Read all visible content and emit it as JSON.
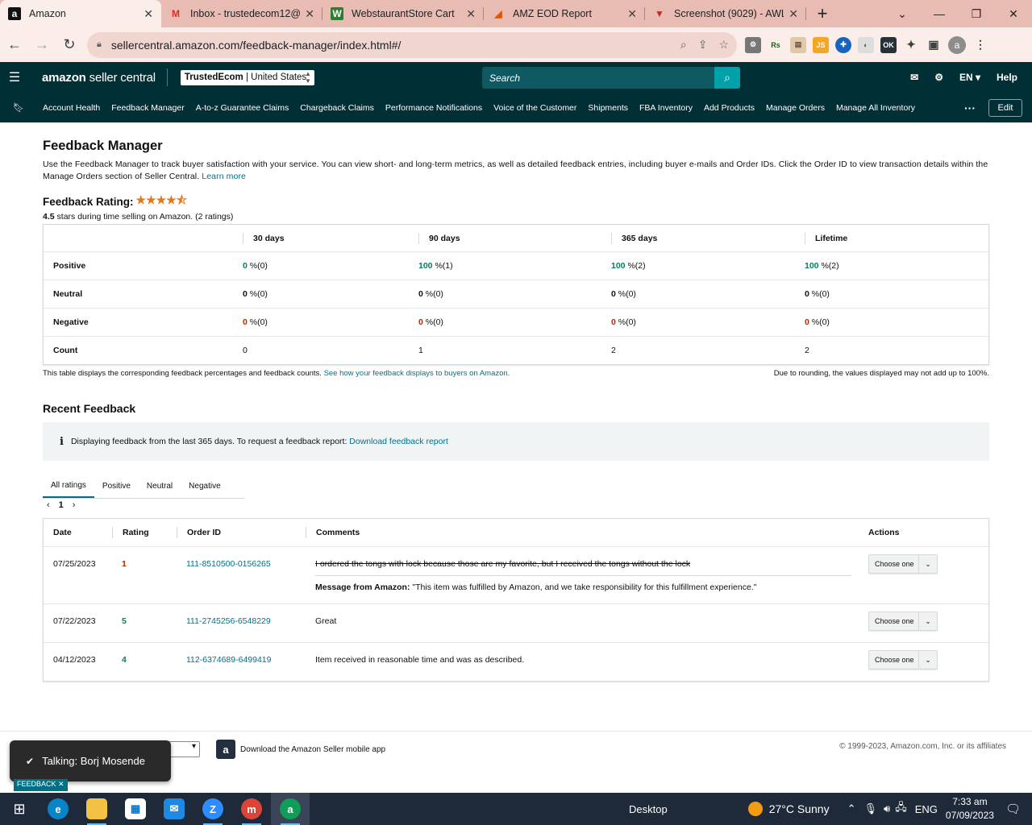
{
  "browser": {
    "tabs": [
      {
        "title": "Amazon",
        "favicon": "a",
        "favicon_bg": "#111111",
        "favicon_color": "#ffffff",
        "active": true
      },
      {
        "title": "Inbox - trustedecom12@g",
        "favicon": "M",
        "favicon_bg": "transparent",
        "favicon_color": "#d93025",
        "active": false
      },
      {
        "title": "WebstaurantStore Cart",
        "favicon": "W",
        "favicon_bg": "#2e7d32",
        "favicon_color": "#ffffff",
        "active": false
      },
      {
        "title": "AMZ EOD Report",
        "favicon": "◢",
        "favicon_bg": "transparent",
        "favicon_color": "#e65100",
        "active": false
      },
      {
        "title": "Screenshot (9029) - AWL",
        "favicon": "▼",
        "favicon_bg": "transparent",
        "favicon_color": "#c62828",
        "active": false
      }
    ],
    "url": "sellercentral.amazon.com/feedback-manager/index.html#/",
    "avatar_letter": "a"
  },
  "header": {
    "brand_bold": "amazon",
    "brand_light": "seller central",
    "account_store": "TrustedEcom",
    "account_region": "United States",
    "search_placeholder": "Search",
    "language": "EN",
    "help": "Help"
  },
  "nav": {
    "items": [
      "Account Health",
      "Feedback Manager",
      "A-to-z Guarantee Claims",
      "Chargeback Claims",
      "Performance Notifications",
      "Voice of the Customer",
      "Shipments",
      "FBA Inventory",
      "Add Products",
      "Manage Orders",
      "Manage All Inventory"
    ],
    "more": "···",
    "edit": "Edit"
  },
  "page": {
    "title": "Feedback Manager",
    "intro": "Use the Feedback Manager to track buyer satisfaction with your service. You can view short- and long-term metrics, as well as detailed feedback entries, including buyer e-mails and Order IDs. Click the Order ID to view transaction details within the Manage Orders section of Seller Central.",
    "learn_more": "Learn more",
    "rating_label": "Feedback Rating:",
    "stars": "★★★★⯪",
    "rating_value": "4.5",
    "rating_rest": " stars during time selling on Amazon. (2 ratings)"
  },
  "metrics": {
    "headers": [
      "30 days",
      "90 days",
      "365 days",
      "Lifetime"
    ],
    "rows": [
      {
        "label": "Positive",
        "cells": [
          [
            "0",
            " %(0)"
          ],
          [
            "100",
            " %(1)"
          ],
          [
            "100",
            " %(2)"
          ],
          [
            "100",
            " %(2)"
          ]
        ]
      },
      {
        "label": "Neutral",
        "cells": [
          [
            "0",
            " %(0)"
          ],
          [
            "0",
            " %(0)"
          ],
          [
            "0",
            " %(0)"
          ],
          [
            "0",
            " %(0)"
          ]
        ]
      },
      {
        "label": "Negative",
        "cells": [
          [
            "0",
            " %(0)"
          ],
          [
            "0",
            " %(0)"
          ],
          [
            "0",
            " %(0)"
          ],
          [
            "0",
            " %(0)"
          ]
        ]
      },
      {
        "label": "Count",
        "cells": [
          [
            "",
            "0"
          ],
          [
            "",
            "1"
          ],
          [
            "",
            "2"
          ],
          [
            "",
            "2"
          ]
        ]
      }
    ],
    "note_text": "This table displays the corresponding feedback percentages and feedback counts.",
    "note_link": "See how your feedback displays to buyers on Amazon.",
    "rounding_note": "Due to rounding, the values displayed may not add up to 100%."
  },
  "recent": {
    "title": "Recent Feedback",
    "info_text": "Displaying feedback from the last 365 days. To request a feedback report:",
    "info_link": "Download feedback report",
    "tabs": [
      "All ratings",
      "Positive",
      "Neutral",
      "Negative"
    ],
    "page": "1",
    "columns": [
      "Date",
      "Rating",
      "Order ID",
      "Comments",
      "Actions"
    ],
    "rows": [
      {
        "date": "07/25/2023",
        "rating": "1",
        "order": "111-8510500-0156265",
        "comment": "I ordered the tongs with lock because those are my favorite, but I received the tongs without the lock",
        "msg_label": "Message from Amazon:",
        "msg": " \"This item was fulfilled by Amazon, and we take responsibility for this fulfillment experience.\"",
        "action": "Choose one"
      },
      {
        "date": "07/22/2023",
        "rating": "5",
        "order": "111-2745256-6548229",
        "comment": "Great",
        "action": "Choose one"
      },
      {
        "date": "04/12/2023",
        "rating": "4",
        "order": "112-6374689-6499419",
        "comment": "Item received in reasonable time and was as described.",
        "action": "Choose one"
      }
    ]
  },
  "footer": {
    "app_text": "Download the Amazon Seller mobile app",
    "copyright": "© 1999-2023, Amazon.com, Inc. or its affiliates",
    "talking": "Talking: Borj Mosende",
    "feedback_tab": "FEEDBACK ✕"
  },
  "taskbar": {
    "desktop": "Desktop",
    "weather": "27°C  Sunny",
    "lang": "ENG",
    "time": "7:33 am",
    "date": "07/09/2023"
  },
  "colors": {
    "positive": "#067d62",
    "negative": "#b12704",
    "link": "#007185",
    "header_bg": "#002f36"
  }
}
